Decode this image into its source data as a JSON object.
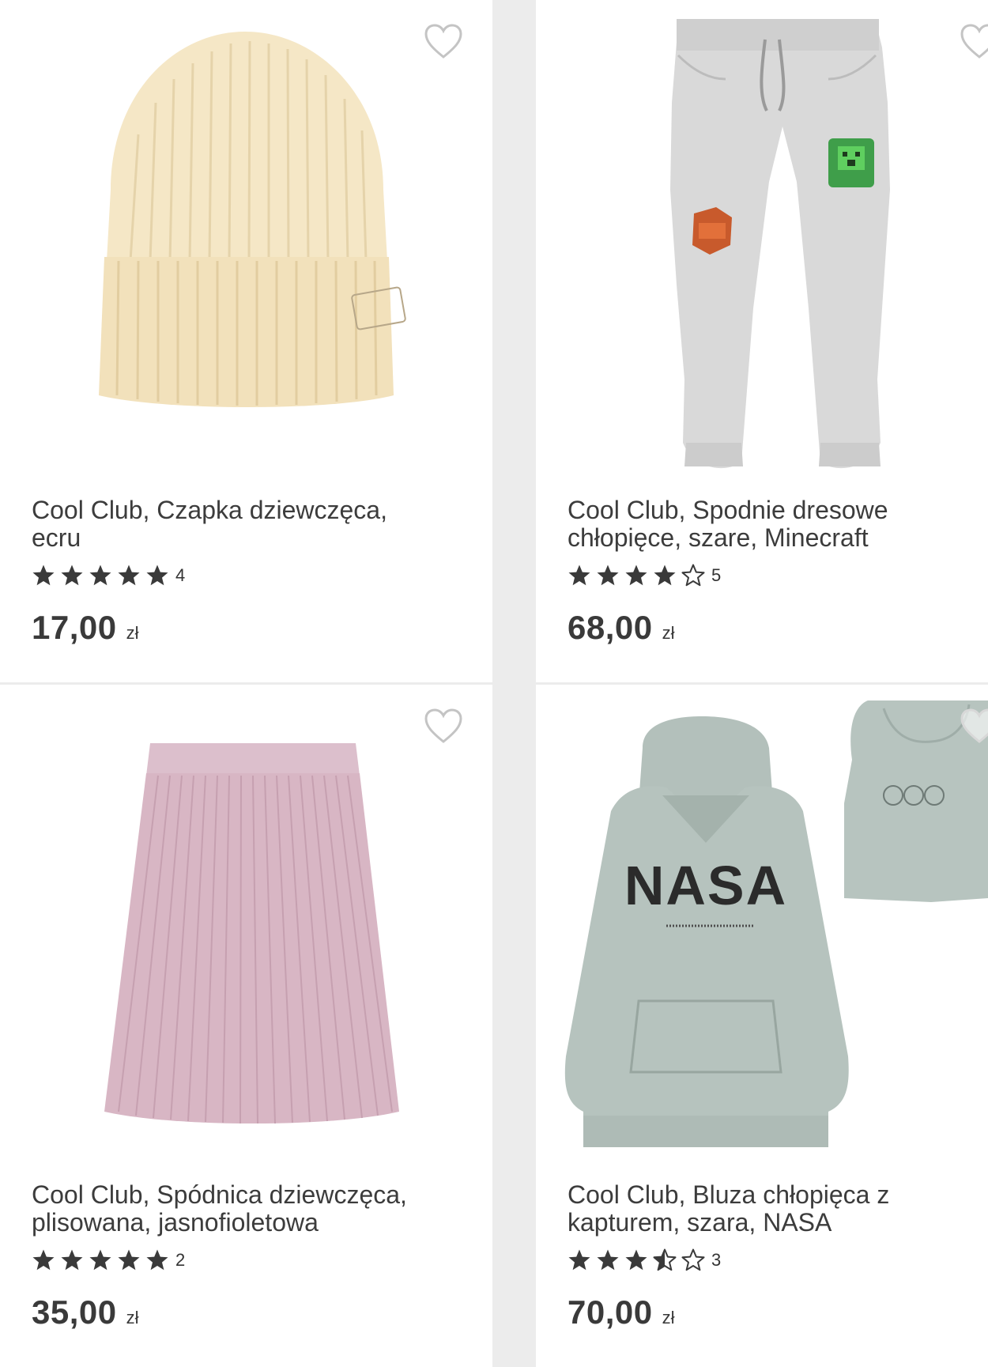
{
  "products": [
    {
      "title": "Cool Club, Czapka dziewczęca, ecru",
      "rating": 5,
      "rating_count": "4",
      "price": "17,00",
      "currency": "zł",
      "image": "ecru-beanie-image"
    },
    {
      "title": "Cool Club, Spodnie dresowe chłopięce, szare, Minecraft",
      "rating": 4,
      "rating_count": "5",
      "price": "68,00",
      "currency": "zł",
      "image": "grey-sweatpants-image"
    },
    {
      "title": "Cool Club, Spódnica dziewczęca, plisowana, jasnofioletowa",
      "rating": 5,
      "rating_count": "2",
      "price": "35,00",
      "currency": "zł",
      "image": "lilac-pleated-skirt-image"
    },
    {
      "title": "Cool Club, Bluza chłopięca z kapturem, szara, NASA",
      "rating": 3.5,
      "rating_count": "3",
      "price": "70,00",
      "currency": "zł",
      "image": "grey-nasa-hoodie-image"
    }
  ],
  "colors": {
    "background": "#ececec",
    "card": "#ffffff",
    "text": "#3a3a3a",
    "star": "#3a3a3a",
    "heart_outline": "#c4c4c4"
  },
  "hoodie_print": {
    "logo": "NASA"
  }
}
